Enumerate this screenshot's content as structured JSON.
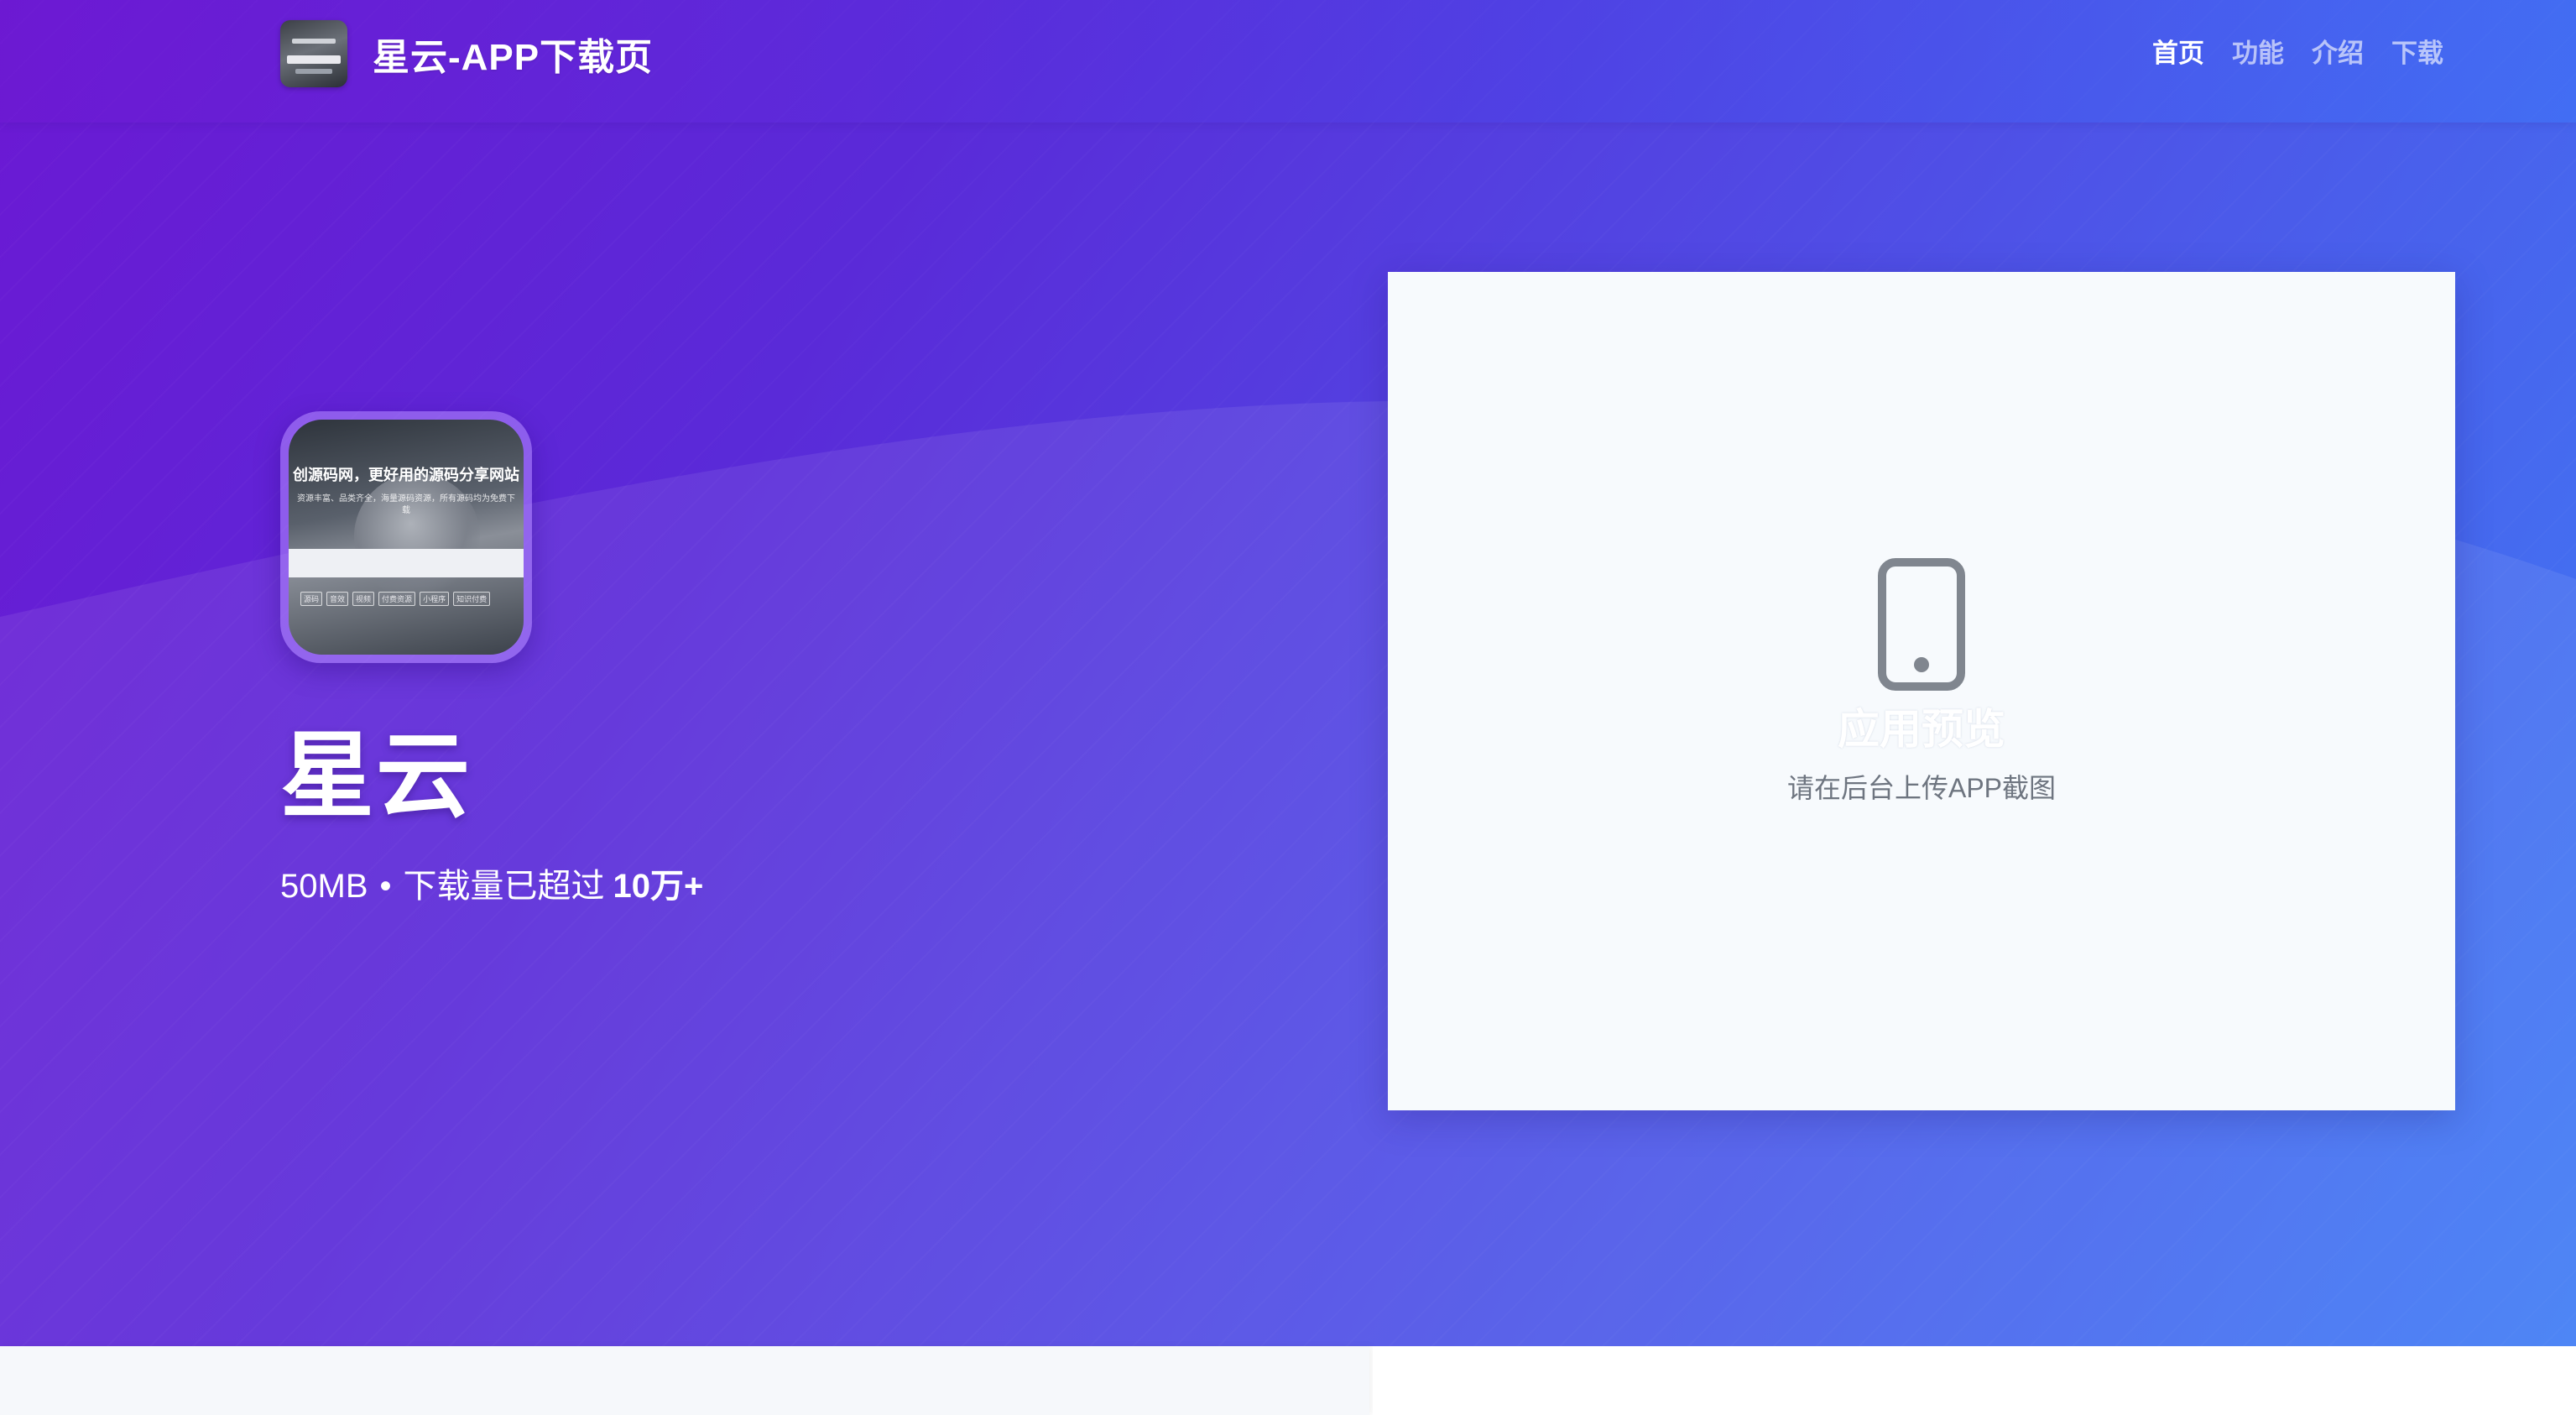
{
  "header": {
    "brand_title": "星云-APP下载页",
    "nav": [
      {
        "label": "首页",
        "active": true
      },
      {
        "label": "功能",
        "active": false
      },
      {
        "label": "介绍",
        "active": false
      },
      {
        "label": "下载",
        "active": false
      }
    ]
  },
  "app": {
    "name": "星云",
    "size": "50MB",
    "separator": "•",
    "downloads_prefix": "下载量已超过",
    "downloads_count": "10万+",
    "icon": {
      "headline": "创源码网，更好用的源码分享网站",
      "subtext": "资源丰富、品类齐全，海量源码资源，所有源码均为免费下载",
      "tags": [
        "源码",
        "音效",
        "视频",
        "付费资源",
        "小程序",
        "知识付费"
      ]
    }
  },
  "preview": {
    "title": "应用预览",
    "hint": "请在后台上传APP截图",
    "icon": "mobile-phone-icon"
  },
  "colors": {
    "hero_gradient_start": "#6b19d3",
    "hero_gradient_end": "#3f7cf5",
    "preview_bg": "#f7fafd",
    "hint_text": "#6e7580"
  }
}
